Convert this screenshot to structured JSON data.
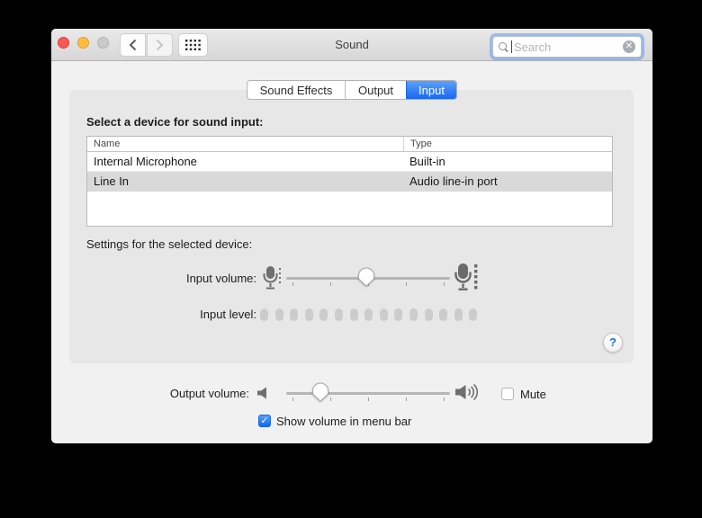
{
  "window": {
    "title": "Sound",
    "search": {
      "placeholder": "Search"
    }
  },
  "tabs": [
    {
      "label": "Sound Effects",
      "selected": false
    },
    {
      "label": "Output",
      "selected": false
    },
    {
      "label": "Input",
      "selected": true
    }
  ],
  "input_panel": {
    "select_device_label": "Select a device for sound input:",
    "table": {
      "columns": [
        "Name",
        "Type"
      ],
      "rows": [
        {
          "name": "Internal Microphone",
          "type": "Built-in",
          "selected": false
        },
        {
          "name": "Line In",
          "type": "Audio line-in port",
          "selected": true
        }
      ]
    },
    "settings_label": "Settings for the selected device:",
    "input_volume": {
      "label": "Input volume:",
      "value_percent": 49
    },
    "input_level": {
      "label": "Input level:",
      "segments": 15,
      "lit": 0
    }
  },
  "footer": {
    "output_volume": {
      "label": "Output volume:",
      "value_percent": 21
    },
    "mute": {
      "label": "Mute",
      "checked": false
    },
    "show_volume": {
      "label": "Show volume in menu bar",
      "checked": true
    }
  },
  "icons": {
    "check_glyph": "✓",
    "clear_glyph": "✕",
    "help_glyph": "?"
  },
  "colors": {
    "accent_blue": "#1a66f0",
    "selected_row_gray": "#d9d9d9",
    "traffic_red": "#fc5753",
    "traffic_yellow": "#fdbc40"
  }
}
